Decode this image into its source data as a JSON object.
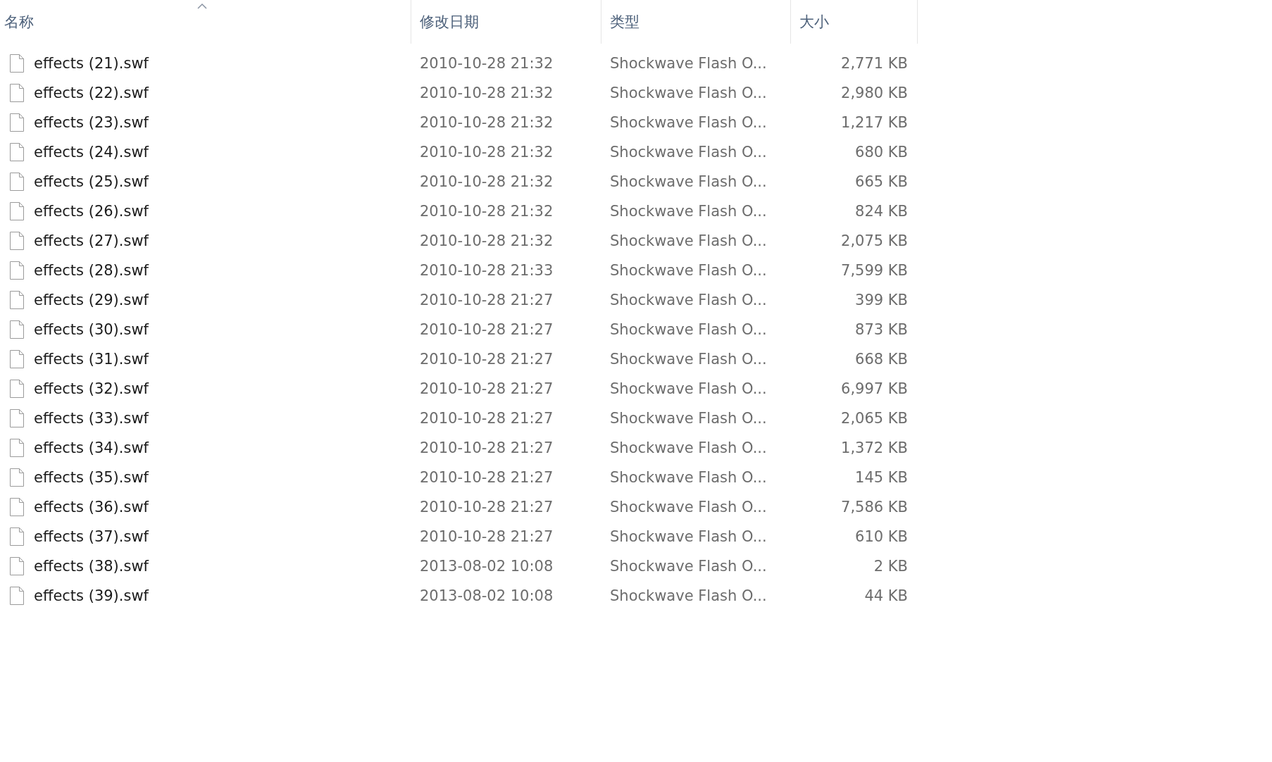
{
  "columns": [
    {
      "label": "名称",
      "sorted": true
    },
    {
      "label": "修改日期",
      "sorted": false
    },
    {
      "label": "类型",
      "sorted": false
    },
    {
      "label": "大小",
      "sorted": false
    }
  ],
  "files": [
    {
      "name": "effects (21).swf",
      "modified": "2010-10-28 21:32",
      "type": "Shockwave Flash O...",
      "size": "2,771 KB"
    },
    {
      "name": "effects (22).swf",
      "modified": "2010-10-28 21:32",
      "type": "Shockwave Flash O...",
      "size": "2,980 KB"
    },
    {
      "name": "effects (23).swf",
      "modified": "2010-10-28 21:32",
      "type": "Shockwave Flash O...",
      "size": "1,217 KB"
    },
    {
      "name": "effects (24).swf",
      "modified": "2010-10-28 21:32",
      "type": "Shockwave Flash O...",
      "size": "680 KB"
    },
    {
      "name": "effects (25).swf",
      "modified": "2010-10-28 21:32",
      "type": "Shockwave Flash O...",
      "size": "665 KB"
    },
    {
      "name": "effects (26).swf",
      "modified": "2010-10-28 21:32",
      "type": "Shockwave Flash O...",
      "size": "824 KB"
    },
    {
      "name": "effects (27).swf",
      "modified": "2010-10-28 21:32",
      "type": "Shockwave Flash O...",
      "size": "2,075 KB"
    },
    {
      "name": "effects (28).swf",
      "modified": "2010-10-28 21:33",
      "type": "Shockwave Flash O...",
      "size": "7,599 KB"
    },
    {
      "name": "effects (29).swf",
      "modified": "2010-10-28 21:27",
      "type": "Shockwave Flash O...",
      "size": "399 KB"
    },
    {
      "name": "effects (30).swf",
      "modified": "2010-10-28 21:27",
      "type": "Shockwave Flash O...",
      "size": "873 KB"
    },
    {
      "name": "effects (31).swf",
      "modified": "2010-10-28 21:27",
      "type": "Shockwave Flash O...",
      "size": "668 KB"
    },
    {
      "name": "effects (32).swf",
      "modified": "2010-10-28 21:27",
      "type": "Shockwave Flash O...",
      "size": "6,997 KB"
    },
    {
      "name": "effects (33).swf",
      "modified": "2010-10-28 21:27",
      "type": "Shockwave Flash O...",
      "size": "2,065 KB"
    },
    {
      "name": "effects (34).swf",
      "modified": "2010-10-28 21:27",
      "type": "Shockwave Flash O...",
      "size": "1,372 KB"
    },
    {
      "name": "effects (35).swf",
      "modified": "2010-10-28 21:27",
      "type": "Shockwave Flash O...",
      "size": "145 KB"
    },
    {
      "name": "effects (36).swf",
      "modified": "2010-10-28 21:27",
      "type": "Shockwave Flash O...",
      "size": "7,586 KB"
    },
    {
      "name": "effects (37).swf",
      "modified": "2010-10-28 21:27",
      "type": "Shockwave Flash O...",
      "size": "610 KB"
    },
    {
      "name": "effects (38).swf",
      "modified": "2013-08-02 10:08",
      "type": "Shockwave Flash O...",
      "size": "2 KB"
    },
    {
      "name": "effects (39).swf",
      "modified": "2013-08-02 10:08",
      "type": "Shockwave Flash O...",
      "size": "44 KB"
    }
  ]
}
